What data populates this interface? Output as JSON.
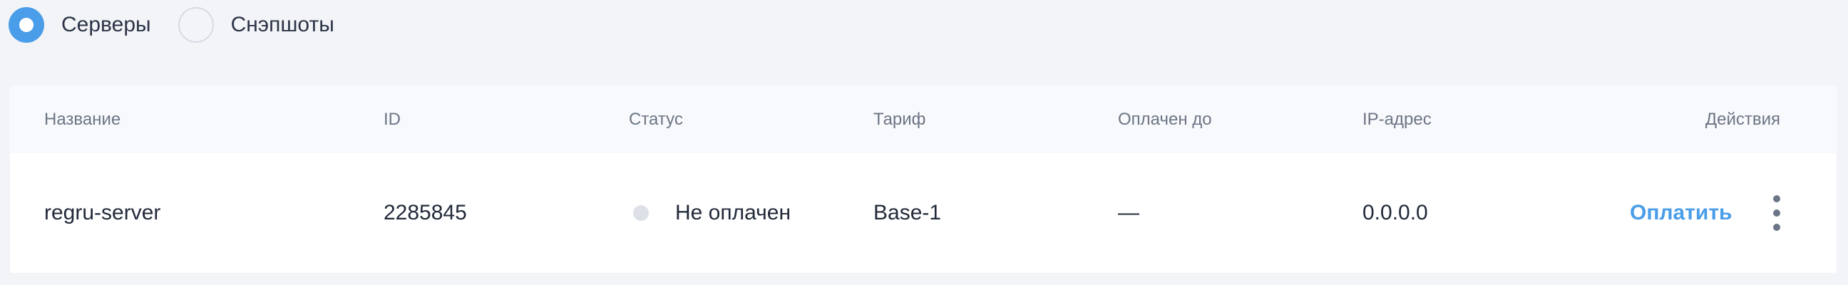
{
  "view_switch": {
    "options": [
      {
        "label": "Серверы",
        "selected": true
      },
      {
        "label": "Снэпшоты",
        "selected": false
      }
    ]
  },
  "table": {
    "columns": {
      "name": "Название",
      "id": "ID",
      "status": "Статус",
      "tariff": "Тариф",
      "paid_until": "Оплачен до",
      "ip": "IP-адрес",
      "actions": "Действия"
    },
    "rows": [
      {
        "name": "regru-server",
        "id": "2285845",
        "status": "Не оплачен",
        "status_color": "#dde1e7",
        "tariff": "Base-1",
        "paid_until": "—",
        "ip": "0.0.0.0",
        "pay_label": "Оплатить",
        "more_icon": "more-vertical-icon"
      }
    ]
  },
  "colors": {
    "accent": "#4a9de8",
    "page_background": "#f3f4f8",
    "header_background": "#f8f9fc"
  }
}
